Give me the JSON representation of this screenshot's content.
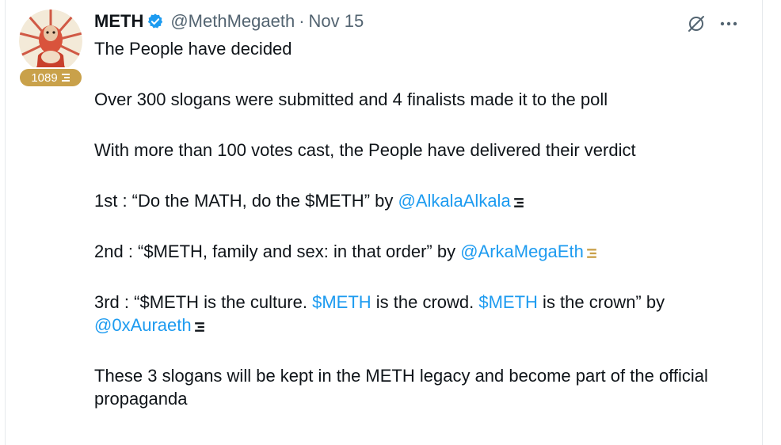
{
  "colors": {
    "link": "#1d9bf0",
    "secondary_text": "#536471",
    "badge_bg": "#c9a14a",
    "verified": "#1d9bf0"
  },
  "author": {
    "name": "METH",
    "handle": "@MethMegaeth",
    "separator": "·",
    "date": "Nov 15",
    "badge_count": "1089",
    "verified_icon": "verified-badge-icon",
    "avatar_icon": "avatar-illustration"
  },
  "actions": {
    "grok_icon": "grok-icon",
    "more_icon": "more-horizontal-icon"
  },
  "tweet": {
    "line1": "The People have decided",
    "line2": "Over 300 slogans were submitted and 4 finalists made it to the poll",
    "line3": "With more than 100 votes cast, the People have delivered their verdict",
    "first": {
      "prefix": "1st : “Do the MATH, do the $METH” by ",
      "mention": "@AlkalaAlkala"
    },
    "second": {
      "prefix": "2nd : “$METH, family and sex: in that order” by ",
      "mention": "@ArkaMegaEth"
    },
    "third": {
      "prefix": "3rd : “$METH is the culture. ",
      "cashtag1": "$METH",
      "middle": " is the crowd. ",
      "cashtag2": "$METH",
      "suffix": " is the crown” by",
      "mention": "@0xAuraeth"
    },
    "closing": "These 3 slogans will be kept in the METH legacy and become part of the official propaganda"
  }
}
